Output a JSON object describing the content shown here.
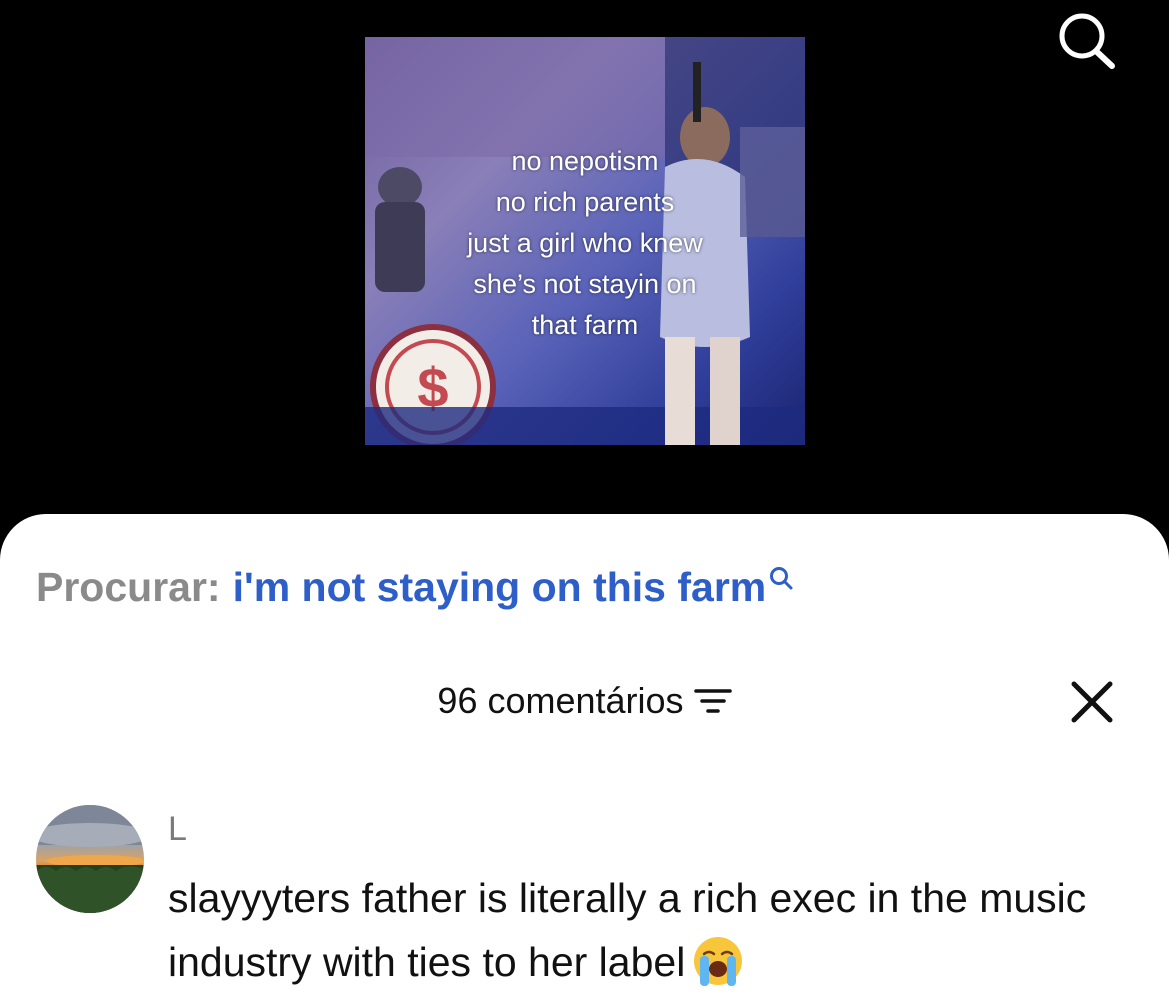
{
  "top_bar": {
    "search_icon": "search-icon"
  },
  "video": {
    "caption": "no nepotism\nno rich parents\njust a girl who knew\nshe’s not stayin on\nthat farm"
  },
  "search_suggestion": {
    "label": "Procurar:",
    "query": "i'm not staying on this farm",
    "icon": "search-icon",
    "query_color": "#2e5ec8"
  },
  "comments": {
    "count_label": "96 comentários",
    "sort_icon": "filter-sort-icon",
    "close_icon": "close-icon",
    "items": [
      {
        "author": "L",
        "text": "slayyyters father is literally a rich exec in the music industry with ties to her label",
        "emoji": "loudly-crying-face-emoji"
      }
    ]
  }
}
